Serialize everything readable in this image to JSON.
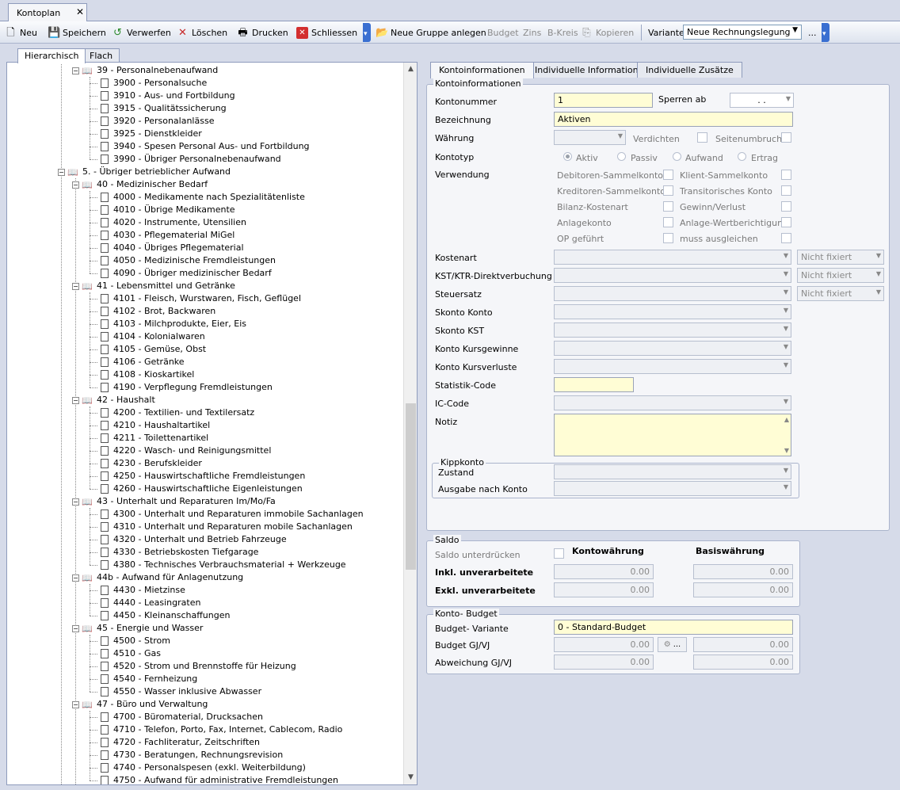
{
  "window": {
    "tab_title": "Kontoplan",
    "close": "✕"
  },
  "toolbar": {
    "neu": "Neu",
    "speichern": "Speichern",
    "verwerfen": "Verwerfen",
    "loeschen": "Löschen",
    "drucken": "Drucken",
    "schliessen": "Schliessen",
    "neue_gruppe": "Neue Gruppe anlegen",
    "budget": "Budget",
    "zins": "Zins",
    "bkreis": "B-Kreis",
    "kopieren": "Kopieren",
    "variante_label": "Variante:",
    "variante_value": "Neue Rechnungslegung",
    "more": "..."
  },
  "tree_tabs": [
    "Hierarchisch",
    "Flach"
  ],
  "tree": [
    {
      "level": 2,
      "type": "group",
      "text": "39 - Personalnebenaufwand"
    },
    {
      "level": 3,
      "type": "account",
      "text": "3900 - Personalsuche"
    },
    {
      "level": 3,
      "type": "account",
      "text": "3910 - Aus- und Fortbildung"
    },
    {
      "level": 3,
      "type": "account",
      "text": "3915 - Qualitätssicherung"
    },
    {
      "level": 3,
      "type": "account",
      "text": "3920 - Personalanlässe"
    },
    {
      "level": 3,
      "type": "account",
      "text": "3925 - Dienstkleider"
    },
    {
      "level": 3,
      "type": "account",
      "text": "3940 - Spesen Personal Aus- und Fortbildung"
    },
    {
      "level": 3,
      "type": "account",
      "text": "3990 - Übriger Personalnebenaufwand"
    },
    {
      "level": 1,
      "type": "group",
      "text": "5. - Übriger betrieblicher Aufwand"
    },
    {
      "level": 2,
      "type": "group",
      "text": "40 - Medizinischer Bedarf"
    },
    {
      "level": 3,
      "type": "account",
      "text": "4000 - Medikamente nach Spezialitätenliste"
    },
    {
      "level": 3,
      "type": "account",
      "text": "4010 - Übrige Medikamente"
    },
    {
      "level": 3,
      "type": "account",
      "text": "4020 - Instrumente, Utensilien"
    },
    {
      "level": 3,
      "type": "account",
      "text": "4030 - Pflegematerial MiGel"
    },
    {
      "level": 3,
      "type": "account",
      "text": "4040 - Übriges Pflegematerial"
    },
    {
      "level": 3,
      "type": "account",
      "text": "4050 - Medizinische Fremdleistungen"
    },
    {
      "level": 3,
      "type": "account",
      "text": "4090 - Übriger medizinischer Bedarf"
    },
    {
      "level": 2,
      "type": "group",
      "text": "41 - Lebensmittel und Getränke"
    },
    {
      "level": 3,
      "type": "account",
      "text": "4101 - Fleisch, Wurstwaren, Fisch, Geflügel"
    },
    {
      "level": 3,
      "type": "account",
      "text": "4102 - Brot, Backwaren"
    },
    {
      "level": 3,
      "type": "account",
      "text": "4103 - Milchprodukte, Eier, Eis"
    },
    {
      "level": 3,
      "type": "account",
      "text": "4104 - Kolonialwaren"
    },
    {
      "level": 3,
      "type": "account",
      "text": "4105 - Gemüse, Obst"
    },
    {
      "level": 3,
      "type": "account",
      "text": "4106 - Getränke"
    },
    {
      "level": 3,
      "type": "account",
      "text": "4108 - Kioskartikel"
    },
    {
      "level": 3,
      "type": "account",
      "text": "4190 - Verpflegung Fremdleistungen"
    },
    {
      "level": 2,
      "type": "group",
      "text": "42 - Haushalt"
    },
    {
      "level": 3,
      "type": "account",
      "text": "4200 - Textilien- und Textilersatz"
    },
    {
      "level": 3,
      "type": "account",
      "text": "4210 - Haushaltartikel"
    },
    {
      "level": 3,
      "type": "account",
      "text": "4211 - Toilettenartikel"
    },
    {
      "level": 3,
      "type": "account",
      "text": "4220 - Wasch- und Reinigungsmittel"
    },
    {
      "level": 3,
      "type": "account",
      "text": "4230 - Berufskleider"
    },
    {
      "level": 3,
      "type": "account",
      "text": "4250 - Hauswirtschaftliche Fremdleistungen"
    },
    {
      "level": 3,
      "type": "account",
      "text": "4260 - Hauswirtschaftliche Eigenleistungen"
    },
    {
      "level": 2,
      "type": "group",
      "text": "43 - Unterhalt und Reparaturen Im/Mo/Fa"
    },
    {
      "level": 3,
      "type": "account",
      "text": "4300 - Unterhalt und Reparaturen immobile Sachanlagen"
    },
    {
      "level": 3,
      "type": "account",
      "text": "4310 - Unterhalt und Reparaturen mobile Sachanlagen"
    },
    {
      "level": 3,
      "type": "account",
      "text": "4320 - Unterhalt und Betrieb Fahrzeuge"
    },
    {
      "level": 3,
      "type": "account",
      "text": "4330 - Betriebskosten Tiefgarage"
    },
    {
      "level": 3,
      "type": "account",
      "text": "4380 - Technisches Verbrauchsmaterial + Werkzeuge"
    },
    {
      "level": 2,
      "type": "group",
      "text": "44b - Aufwand für Anlagenutzung"
    },
    {
      "level": 3,
      "type": "account",
      "text": "4430 - Mietzinse"
    },
    {
      "level": 3,
      "type": "account",
      "text": "4440 - Leasingraten"
    },
    {
      "level": 3,
      "type": "account",
      "text": "4450 - Kleinanschaffungen"
    },
    {
      "level": 2,
      "type": "group",
      "text": "45 - Energie und Wasser"
    },
    {
      "level": 3,
      "type": "account",
      "text": "4500 - Strom"
    },
    {
      "level": 3,
      "type": "account",
      "text": "4510 - Gas"
    },
    {
      "level": 3,
      "type": "account",
      "text": "4520 - Strom und Brennstoffe für Heizung"
    },
    {
      "level": 3,
      "type": "account",
      "text": "4540 - Fernheizung"
    },
    {
      "level": 3,
      "type": "account",
      "text": "4550 - Wasser inklusive Abwasser"
    },
    {
      "level": 2,
      "type": "group",
      "text": "47 - Büro und Verwaltung"
    },
    {
      "level": 3,
      "type": "account",
      "text": "4700 - Büromaterial, Drucksachen"
    },
    {
      "level": 3,
      "type": "account",
      "text": "4710 - Telefon, Porto, Fax, Internet, Cablecom, Radio"
    },
    {
      "level": 3,
      "type": "account",
      "text": "4720 - Fachliteratur, Zeitschriften"
    },
    {
      "level": 3,
      "type": "account",
      "text": "4730 - Beratungen, Rechnungsrevision"
    },
    {
      "level": 3,
      "type": "account",
      "text": "4740 - Personalspesen (exkl. Weiterbildung)"
    },
    {
      "level": 3,
      "type": "account",
      "text": "4750 - Aufwand für administrative Fremdleistungen"
    }
  ],
  "detail_tabs": [
    "Kontoinformationen",
    "Individuelle Informationen",
    "Individuelle Zusätze"
  ],
  "konto": {
    "group_title": "Kontoinformationen",
    "kontonummer_label": "Kontonummer",
    "kontonummer": "1",
    "sperren_label": "Sperren ab",
    "sperren_value": ".   .",
    "bezeichnung_label": "Bezeichnung",
    "bezeichnung": "Aktiven",
    "waehrung_label": "Währung",
    "verdichten": "Verdichten",
    "seitenumbruch": "Seitenumbruch",
    "kontotyp_label": "Kontotyp",
    "aktiv": "Aktiv",
    "passiv": "Passiv",
    "aufwand": "Aufwand",
    "ertrag": "Ertrag",
    "verwendung_label": "Verwendung",
    "verwendung_left": [
      "Debitoren-Sammelkonto",
      "Kreditoren-Sammelkonto",
      "Bilanz-Kostenart",
      "Anlagekonto",
      "OP geführt"
    ],
    "verwendung_right": [
      "Klient-Sammelkonto",
      "Transitorisches Konto",
      "Gewinn/Verlust",
      "Anlage-Wertberichtigung",
      "muss ausgleichen"
    ],
    "kostenart": "Kostenart",
    "kst_ktr": "KST/KTR-Direktverbuchung",
    "steuersatz": "Steuersatz",
    "nicht_fixiert": "Nicht fixiert",
    "skonto_konto": "Skonto Konto",
    "skonto_kst": "Skonto KST",
    "kursgewinne": "Konto Kursgewinne",
    "kursverluste": "Konto Kursverluste",
    "statistik": "Statistik-Code",
    "ic_code": "IC-Code",
    "notiz": "Notiz",
    "kipp_title": "Kippkonto",
    "zustand": "Zustand",
    "ausgabe": "Ausgabe nach Konto"
  },
  "saldo": {
    "title": "Saldo",
    "unterdruecken": "Saldo unterdrücken",
    "kontowaehrung": "Kontowährung",
    "basiswaehrung": "Basiswährung",
    "inkl": "Inkl. unverarbeitete",
    "exkl": "Exkl. unverarbeitete",
    "zero": "0.00"
  },
  "budget": {
    "title": "Konto- Budget",
    "variante_label": "Budget- Variante",
    "variante_value": "0   - Standard-Budget",
    "gjvj": "Budget GJ/VJ",
    "abweichung": "Abweichung GJ/VJ",
    "zero": "0.00",
    "btn": "..."
  }
}
